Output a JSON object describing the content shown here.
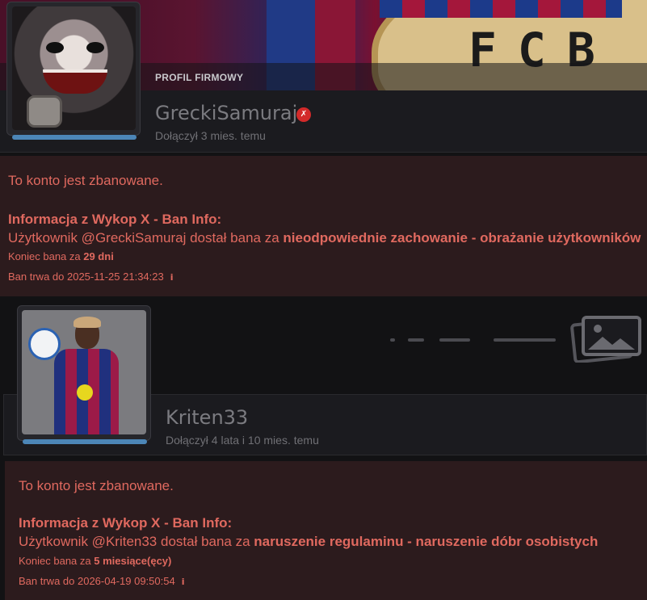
{
  "profiles": [
    {
      "tag": "PROFIL FIRMOWY",
      "username": "GreckiSamuraj",
      "badge_symbol": "✗",
      "joined": "Dołączył 3 mies. temu",
      "banner_text": "FCB",
      "avatar_icon": "joker-avatar",
      "level_fraction": 1.0,
      "ban": {
        "status": "To konto jest zbanowane.",
        "info_title": "Informacja z Wykop X - Ban Info:",
        "reason_prefix": "Użytkownik @GreckiSamuraj dostał bana za ",
        "reason": "nieodpowiednie zachowanie - obrażanie użytkowników",
        "end_prefix": "Koniec bana za ",
        "end_value": "29 dni",
        "until": "Ban trwa do 2025-11-25 21:34:23",
        "info_icon": "i"
      }
    },
    {
      "tag": "",
      "username": "Kriten33",
      "joined": "Dołączył 4 lata i 10 mies. temu",
      "avatar_icon": "football-player-avatar",
      "banner_icon": "image-placeholder-icon",
      "level_fraction": 1.0,
      "ban": {
        "status": "To konto jest zbanowane.",
        "info_title": "Informacja z Wykop X - Ban Info:",
        "reason_prefix": "Użytkownik @Kriten33 dostał bana za ",
        "reason": "naruszenie regulaminu - naruszenie dóbr osobistych",
        "end_prefix": "Koniec bana za ",
        "end_value": "5 miesiące(ęcy)",
        "until": "Ban trwa do 2026-04-19 09:50:54",
        "info_icon": "i"
      }
    }
  ],
  "colors": {
    "page_bg": "#121214",
    "card_bg": "#1b1b1f",
    "ban_bg": "#2c1b1d",
    "ban_text": "#e0695f",
    "progress": "#4c86b7",
    "badge": "#d32a2a"
  }
}
